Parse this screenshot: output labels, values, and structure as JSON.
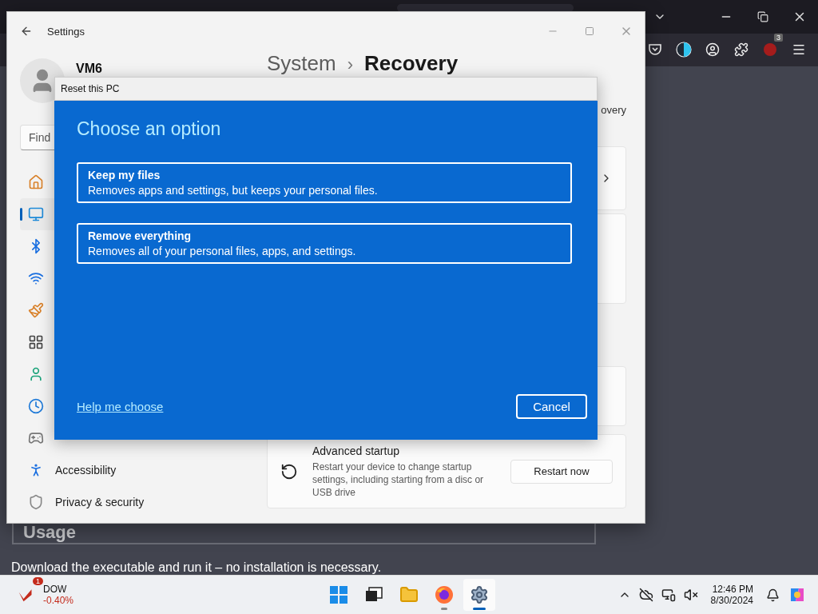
{
  "browser": {
    "extension_badge": "3",
    "content": {
      "heading": "Usage",
      "text": "Download the executable and run it – no installation is necessary."
    }
  },
  "settings": {
    "title": "Settings",
    "user": "VM6",
    "search": {
      "placeholder": "Find"
    },
    "nav": [
      {
        "selected": false
      },
      {
        "selected": true
      },
      {
        "selected": false
      },
      {
        "selected": false
      },
      {
        "selected": false
      },
      {
        "selected": false
      },
      {
        "selected": false
      },
      {
        "selected": false
      },
      {
        "selected": false
      },
      {
        "label": "Accessibility",
        "selected": false
      },
      {
        "label": "Privacy & security",
        "selected": false
      }
    ],
    "breadcrumb": {
      "parent": "System",
      "separator": "›",
      "current": "Recovery"
    },
    "description_fragment": "overy",
    "advanced_startup": {
      "title": "Advanced startup",
      "description": "Restart your device to change startup settings, including starting from a disc or USB drive",
      "button": "Restart now"
    }
  },
  "dialog": {
    "title": "Reset this PC",
    "heading": "Choose an option",
    "options": [
      {
        "title": "Keep my files",
        "description": "Removes apps and settings, but keeps your personal files."
      },
      {
        "title": "Remove everything",
        "description": "Removes all of your personal files, apps, and settings."
      }
    ],
    "link": "Help me choose",
    "cancel": "Cancel"
  },
  "taskbar": {
    "stock": {
      "badge": "1",
      "symbol": "DOW",
      "change": "-0.40%"
    },
    "apps": [
      {
        "running": false,
        "selected": false
      },
      {
        "running": false,
        "selected": false
      },
      {
        "running": false,
        "selected": false
      },
      {
        "running": true,
        "selected": false
      },
      {
        "running": true,
        "selected": true
      }
    ],
    "time": "12:46 PM",
    "date": "8/30/2024"
  }
}
